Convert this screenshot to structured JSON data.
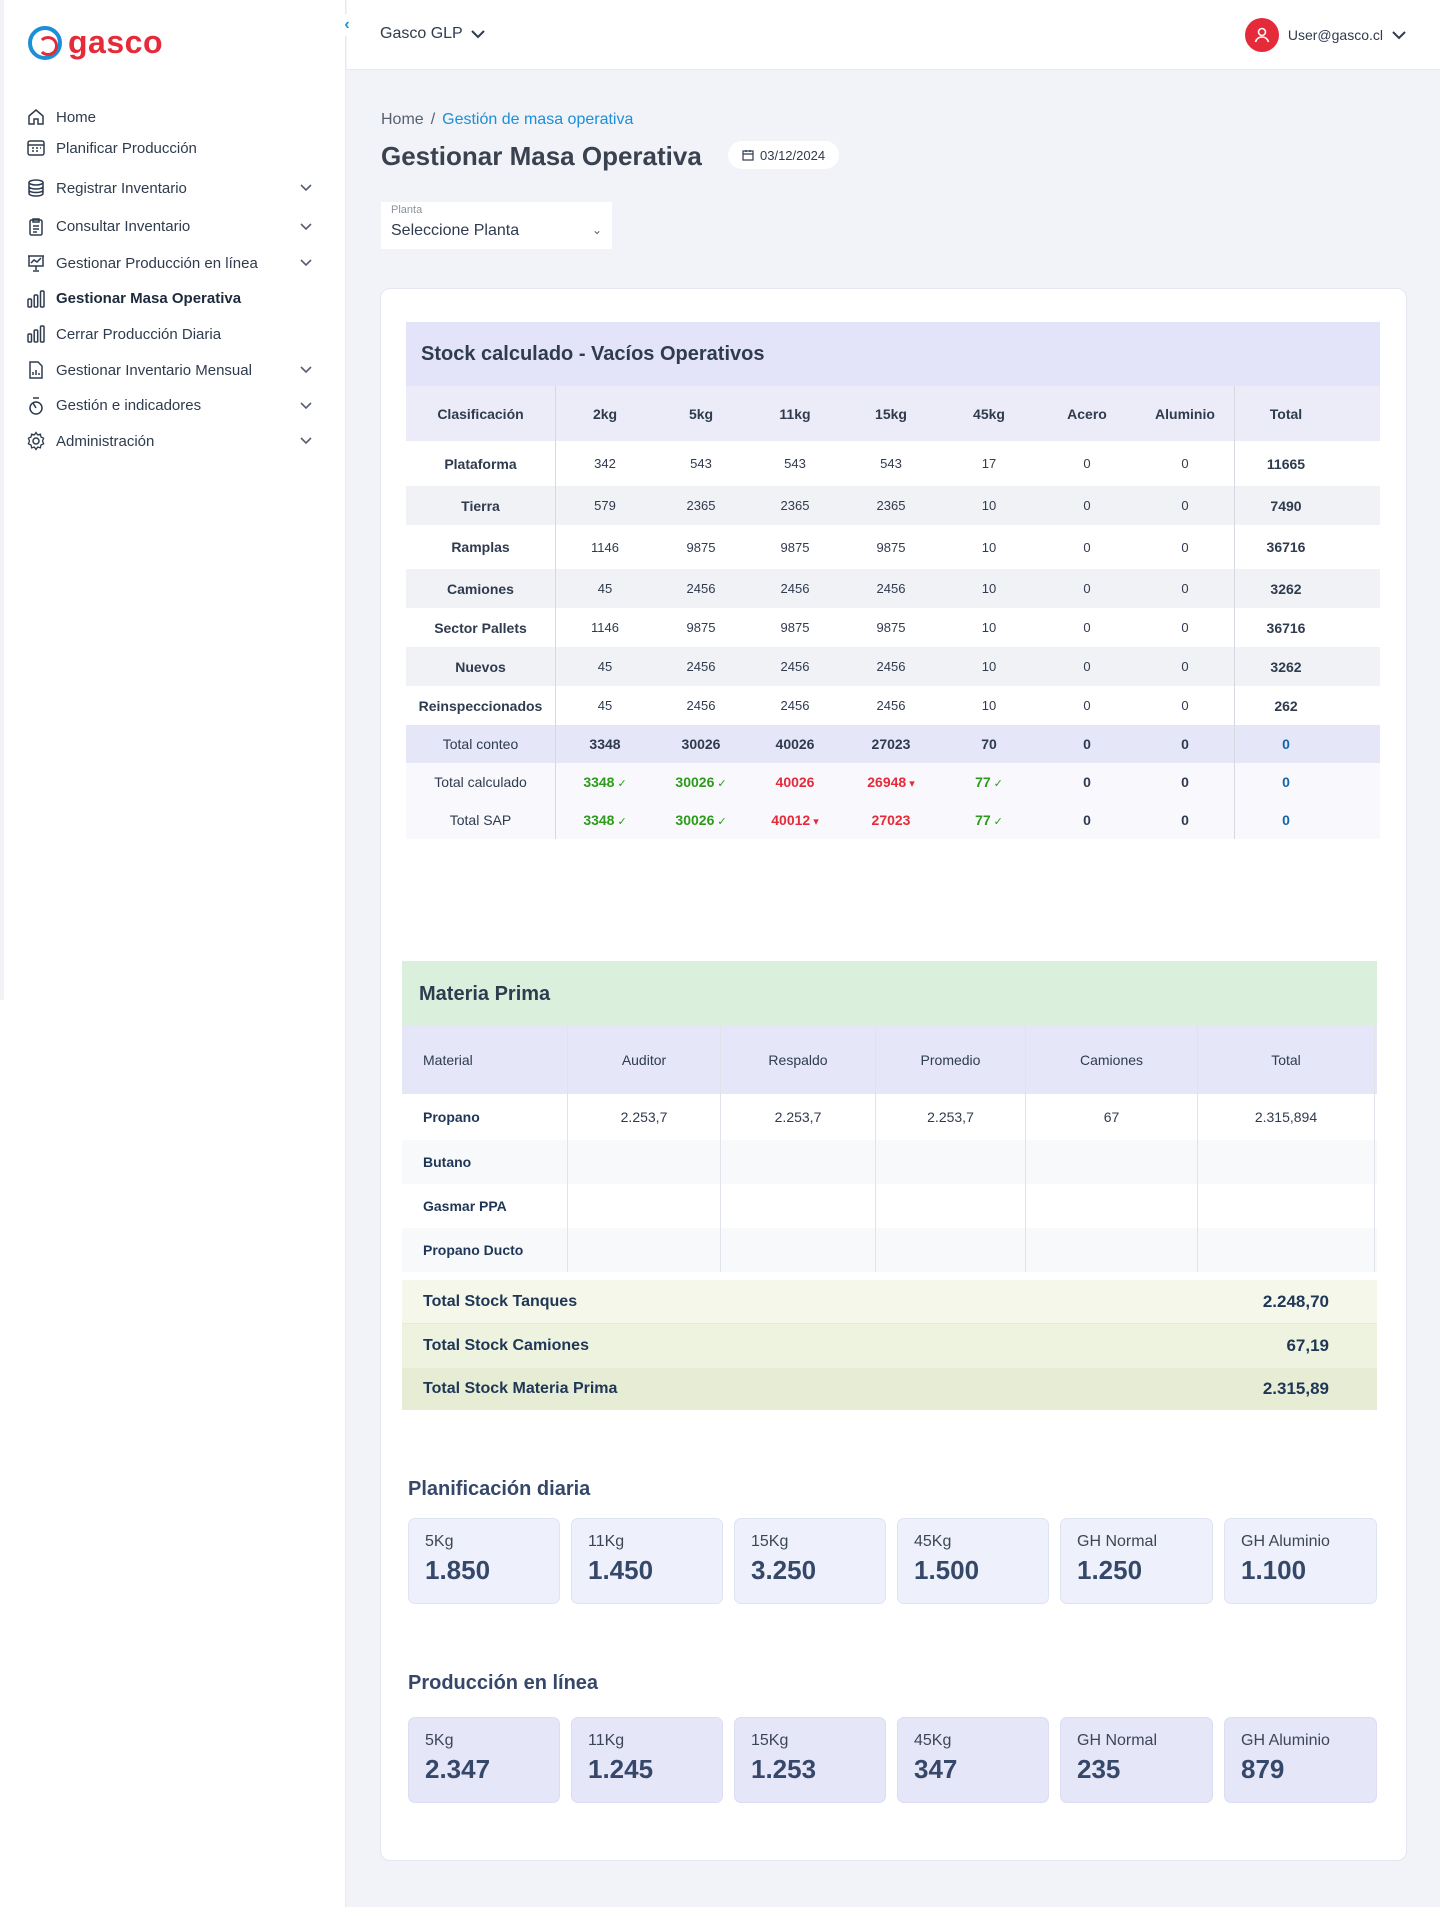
{
  "brand": {
    "name": "gasco"
  },
  "sidebar": {
    "items": [
      {
        "label": "Home",
        "icon": "home-icon",
        "has_children": false,
        "active": false
      },
      {
        "label": "Planificar Producción",
        "icon": "calendar-grid-icon",
        "has_children": false,
        "active": false
      },
      {
        "label": "Registrar Inventario",
        "icon": "database-icon",
        "has_children": true,
        "active": false
      },
      {
        "label": "Consultar Inventario",
        "icon": "clipboard-icon",
        "has_children": true,
        "active": false
      },
      {
        "label": "Gestionar Producción en línea",
        "icon": "presentation-chart-icon",
        "has_children": true,
        "active": false
      },
      {
        "label": "Gestionar Masa Operativa",
        "icon": "bar-chart-icon",
        "has_children": false,
        "active": true
      },
      {
        "label": "Cerrar Producción Diaria",
        "icon": "bar-chart-icon",
        "has_children": false,
        "active": false
      },
      {
        "label": "Gestionar Inventario Mensual",
        "icon": "document-chart-icon",
        "has_children": true,
        "active": false
      },
      {
        "label": "Gestión e indicadores",
        "icon": "gauge-icon",
        "has_children": true,
        "active": false
      },
      {
        "label": "Administración",
        "icon": "gear-icon",
        "has_children": true,
        "active": false
      }
    ]
  },
  "topbar": {
    "org": "Gasco GLP",
    "user": "User@gasco.cl"
  },
  "breadcrumb": {
    "home": "Home",
    "separator": "/",
    "current": "Gestión de masa operativa"
  },
  "page": {
    "title": "Gestionar Masa Operativa",
    "date": "03/12/2024"
  },
  "planta": {
    "label": "Planta",
    "value": "Seleccione Planta"
  },
  "stock": {
    "title": "Stock calculado - Vacíos Operativos",
    "columns": [
      "Clasificación",
      "2kg",
      "5kg",
      "11kg",
      "15kg",
      "45kg",
      "Acero",
      "Aluminio",
      "Total"
    ],
    "rows": [
      [
        "Plataforma",
        "342",
        "543",
        "543",
        "543",
        "17",
        "0",
        "0",
        "11665"
      ],
      [
        "Tierra",
        "579",
        "2365",
        "2365",
        "2365",
        "10",
        "0",
        "0",
        "7490"
      ],
      [
        "Ramplas",
        "1146",
        "9875",
        "9875",
        "9875",
        "10",
        "0",
        "0",
        "36716"
      ],
      [
        "Camiones",
        "45",
        "2456",
        "2456",
        "2456",
        "10",
        "0",
        "0",
        "3262"
      ],
      [
        "Sector Pallets",
        "1146",
        "9875",
        "9875",
        "9875",
        "10",
        "0",
        "0",
        "36716"
      ],
      [
        "Nuevos",
        "45",
        "2456",
        "2456",
        "2456",
        "10",
        "0",
        "0",
        "3262"
      ],
      [
        "Reinspeccionados",
        "45",
        "2456",
        "2456",
        "2456",
        "10",
        "0",
        "0",
        "262"
      ]
    ],
    "totals": [
      {
        "label": "Total conteo",
        "values": [
          "3348",
          "30026",
          "40026",
          "27023",
          "70",
          "0",
          "0"
        ],
        "status": [
          "",
          "",
          "",
          "",
          "",
          "",
          ""
        ],
        "total": "0"
      },
      {
        "label": "Total calculado",
        "values": [
          "3348",
          "30026",
          "40026",
          "26948",
          "77",
          "0",
          "0"
        ],
        "status": [
          "ok",
          "ok",
          "bad",
          "bad-down",
          "ok",
          "",
          ""
        ],
        "total": "0"
      },
      {
        "label": "Total SAP",
        "values": [
          "3348",
          "30026",
          "40012",
          "27023",
          "77",
          "0",
          "0"
        ],
        "status": [
          "ok",
          "ok",
          "bad-down",
          "bad",
          "ok",
          "",
          ""
        ],
        "total": "0"
      }
    ],
    "status_colors": {
      "ok": "#2c9b1a",
      "bad": "#e52b3a",
      "total": "#1565a6"
    }
  },
  "materia_prima": {
    "title": "Materia Prima",
    "columns": [
      "Material",
      "Auditor",
      "Respaldo",
      "Promedio",
      "Camiones",
      "Total"
    ],
    "rows": [
      [
        "Propano",
        "2.253,7",
        "2.253,7",
        "2.253,7",
        "67",
        "2.315,894"
      ],
      [
        "Butano",
        "",
        "",
        "",
        "",
        ""
      ],
      [
        "Gasmar PPA",
        "",
        "",
        "",
        "",
        ""
      ],
      [
        "Propano Ducto",
        "",
        "",
        "",
        "",
        ""
      ]
    ],
    "totals": [
      {
        "label": "Total Stock Tanques",
        "value": "2.248,70"
      },
      {
        "label": "Total Stock Camiones",
        "value": "67,19"
      },
      {
        "label": "Total Stock Materia Prima",
        "value": "2.315,89"
      }
    ]
  },
  "planificacion": {
    "title": "Planificación diaria",
    "items": [
      {
        "label": "5Kg",
        "value": "1.850"
      },
      {
        "label": "11Kg",
        "value": "1.450"
      },
      {
        "label": "15Kg",
        "value": "3.250"
      },
      {
        "label": "45Kg",
        "value": "1.500"
      },
      {
        "label": "GH Normal",
        "value": "1.250"
      },
      {
        "label": "GH Aluminio",
        "value": "1.100"
      }
    ]
  },
  "produccion": {
    "title": "Producción en línea",
    "items": [
      {
        "label": "5Kg",
        "value": "2.347"
      },
      {
        "label": "11Kg",
        "value": "1.245"
      },
      {
        "label": "15Kg",
        "value": "1.253"
      },
      {
        "label": "45Kg",
        "value": "347"
      },
      {
        "label": "GH Normal",
        "value": "235"
      },
      {
        "label": "GH Aluminio",
        "value": "879"
      }
    ]
  }
}
